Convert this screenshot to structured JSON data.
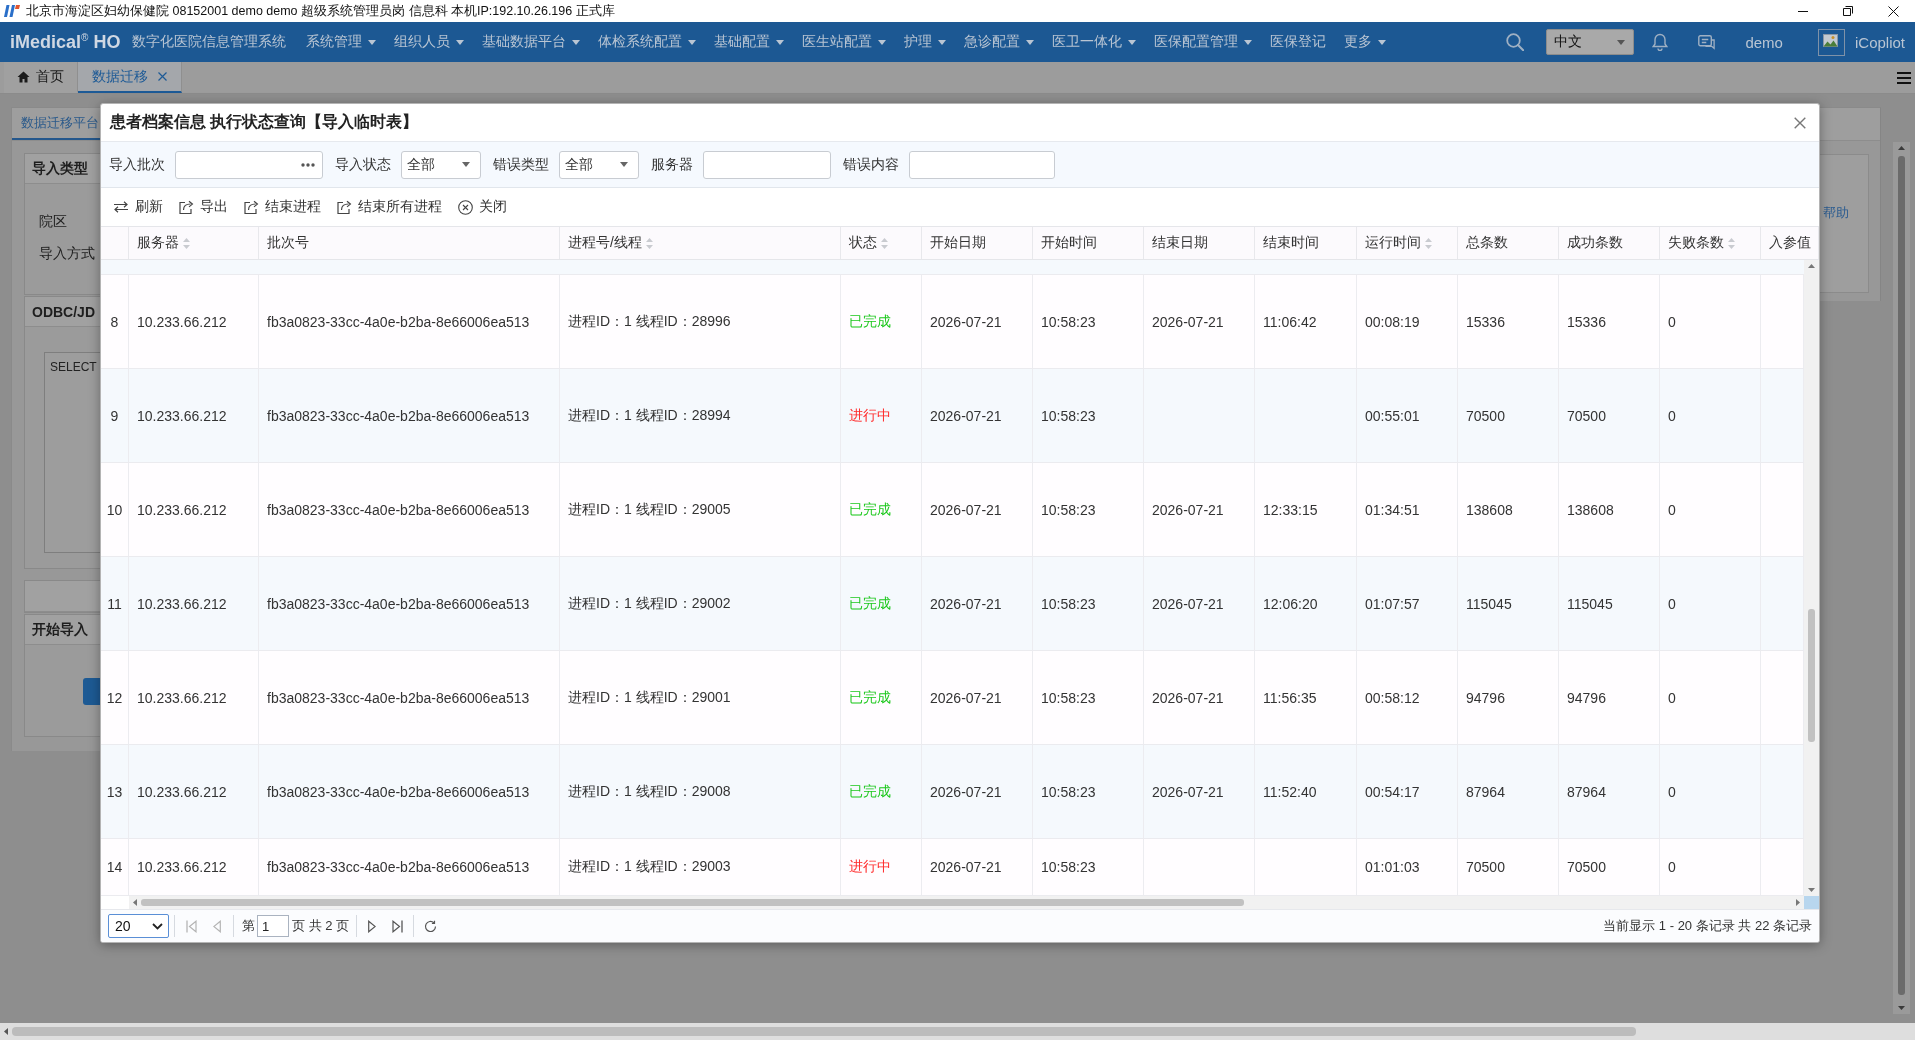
{
  "window": {
    "title": "北京市海淀区妇幼保健院 08152001 demo demo 超级系统管理员岗 信息科 本机IP:192.10.26.196 正式库"
  },
  "header": {
    "logo": "iMedical$^{®}$ HO",
    "system_name": "数字化医院信息管理系统",
    "menu": [
      {
        "label": "系统管理",
        "dropdown": true
      },
      {
        "label": "组织人员",
        "dropdown": true
      },
      {
        "label": "基础数据平台",
        "dropdown": true
      },
      {
        "label": "体检系统配置",
        "dropdown": true
      },
      {
        "label": "基础配置",
        "dropdown": true
      },
      {
        "label": "医生站配置",
        "dropdown": true
      },
      {
        "label": "护理",
        "dropdown": true
      },
      {
        "label": "急诊配置",
        "dropdown": true
      },
      {
        "label": "医卫一体化",
        "dropdown": true
      },
      {
        "label": "医保配置管理",
        "dropdown": true
      },
      {
        "label": "医保登记",
        "dropdown": false
      },
      {
        "label": "更多",
        "dropdown": true
      }
    ],
    "language": "中文",
    "user": "demo",
    "assistant": "iCopliot"
  },
  "tabs": [
    {
      "kind": "home",
      "label": "首页",
      "selected": false,
      "closable": false
    },
    {
      "kind": "page",
      "label": "数据迁移",
      "selected": true,
      "closable": true
    }
  ],
  "page": {
    "panel_tab": "数据迁移平台",
    "sections": [
      {
        "kind": "form",
        "title": "导入类型",
        "fields": [
          "院区",
          "导入方式"
        ]
      },
      {
        "kind": "query",
        "title": "ODBC/JD",
        "query": "SELECT"
      },
      {
        "kind": "blank"
      },
      {
        "kind": "action",
        "title": "开始导入"
      }
    ],
    "help": "帮助"
  },
  "dialog": {
    "title": "患者档案信息 执行状态查询【导入临时表】",
    "filters": [
      {
        "kind": "picker",
        "label": "导入批次"
      },
      {
        "kind": "select",
        "label": "导入状态",
        "value": "全部"
      },
      {
        "kind": "select",
        "label": "错误类型",
        "value": "全部"
      },
      {
        "kind": "text",
        "label": "服务器"
      },
      {
        "kind": "text",
        "label": "错误内容"
      }
    ],
    "toolbar": [
      {
        "kind": "refresh",
        "label": "刷新"
      },
      {
        "kind": "export",
        "label": "导出"
      },
      {
        "kind": "export",
        "label": "结束进程"
      },
      {
        "kind": "export",
        "label": "结束所有进程"
      },
      {
        "kind": "close",
        "label": "关闭"
      }
    ],
    "table": {
      "columns": [
        {
          "label": "服务器",
          "sortable": true
        },
        {
          "label": "批次号",
          "sortable": false
        },
        {
          "label": "进程号/线程",
          "sortable": true
        },
        {
          "label": "状态",
          "sortable": true
        },
        {
          "label": "开始日期",
          "sortable": false
        },
        {
          "label": "开始时间",
          "sortable": false
        },
        {
          "label": "结束日期",
          "sortable": false
        },
        {
          "label": "结束时间",
          "sortable": false
        },
        {
          "label": "运行时间",
          "sortable": true
        },
        {
          "label": "总条数",
          "sortable": false
        },
        {
          "label": "成功条数",
          "sortable": false
        },
        {
          "label": "失败条数",
          "sortable": true
        },
        {
          "label": "入参值",
          "sortable": false
        }
      ],
      "rows": [
        {
          "number": "8",
          "server": "10.233.66.212",
          "batch": "fb3a0823-33cc-4a0e-b2ba-8e66006ea513",
          "process": "进程ID：1 线程ID：28996",
          "status": {
            "text": "已完成",
            "color": "#1ec81e"
          },
          "start_date": "2026-07-21",
          "start_time": "10:58:23",
          "end_date": "2026-07-21",
          "end_time": "11:06:42",
          "run_time": "00:08:19",
          "total": "15336",
          "success": "15336",
          "failed": "0"
        },
        {
          "number": "9",
          "server": "10.233.66.212",
          "batch": "fb3a0823-33cc-4a0e-b2ba-8e66006ea513",
          "process": "进程ID：1 线程ID：28994",
          "status": {
            "text": "进行中",
            "color": "#ff2a2a"
          },
          "start_date": "2026-07-21",
          "start_time": "10:58:23",
          "run_time": "00:55:01",
          "total": "70500",
          "success": "70500",
          "failed": "0"
        },
        {
          "number": "10",
          "server": "10.233.66.212",
          "batch": "fb3a0823-33cc-4a0e-b2ba-8e66006ea513",
          "process": "进程ID：1 线程ID：29005",
          "status": {
            "text": "已完成",
            "color": "#1ec81e"
          },
          "start_date": "2026-07-21",
          "start_time": "10:58:23",
          "end_date": "2026-07-21",
          "end_time": "12:33:15",
          "run_time": "01:34:51",
          "total": "138608",
          "success": "138608",
          "failed": "0"
        },
        {
          "number": "11",
          "server": "10.233.66.212",
          "batch": "fb3a0823-33cc-4a0e-b2ba-8e66006ea513",
          "process": "进程ID：1 线程ID：29002",
          "status": {
            "text": "已完成",
            "color": "#1ec81e"
          },
          "start_date": "2026-07-21",
          "start_time": "10:58:23",
          "end_date": "2026-07-21",
          "end_time": "12:06:20",
          "run_time": "01:07:57",
          "total": "115045",
          "success": "115045",
          "failed": "0"
        },
        {
          "number": "12",
          "server": "10.233.66.212",
          "batch": "fb3a0823-33cc-4a0e-b2ba-8e66006ea513",
          "process": "进程ID：1 线程ID：29001",
          "status": {
            "text": "已完成",
            "color": "#1ec81e"
          },
          "start_date": "2026-07-21",
          "start_time": "10:58:23",
          "end_date": "2026-07-21",
          "end_time": "11:56:35",
          "run_time": "00:58:12",
          "total": "94796",
          "success": "94796",
          "failed": "0"
        },
        {
          "number": "13",
          "server": "10.233.66.212",
          "batch": "fb3a0823-33cc-4a0e-b2ba-8e66006ea513",
          "process": "进程ID：1 线程ID：29008",
          "status": {
            "text": "已完成",
            "color": "#1ec81e"
          },
          "start_date": "2026-07-21",
          "start_time": "10:58:23",
          "end_date": "2026-07-21",
          "end_time": "11:52:40",
          "run_time": "00:54:17",
          "total": "87964",
          "success": "87964",
          "failed": "0"
        },
        {
          "number": "14",
          "server": "10.233.66.212",
          "batch": "fb3a0823-33cc-4a0e-b2ba-8e66006ea513",
          "process": "进程ID：1 线程ID：29003",
          "status": {
            "text": "进行中",
            "color": "#ff2a2a"
          },
          "start_date": "2026-07-21",
          "start_time": "10:58:23",
          "run_time": "01:01:03",
          "total": "70500",
          "success": "70500",
          "failed": "0"
        }
      ]
    },
    "pager": {
      "page_size": "20",
      "controls": [
        {
          "kind": "first",
          "disabled": true
        },
        {
          "kind": "prev",
          "disabled": true
        },
        {
          "kind": "page",
          "disabled": false,
          "prefix": "第",
          "value": "1",
          "suffix": "页 共 2 页"
        },
        {
          "kind": "next",
          "disabled": false
        },
        {
          "kind": "last",
          "disabled": false
        },
        {
          "kind": "reload",
          "disabled": false
        }
      ],
      "summary": "当前显示 1 - 20 条记录 共 22 条记录"
    }
  }
}
